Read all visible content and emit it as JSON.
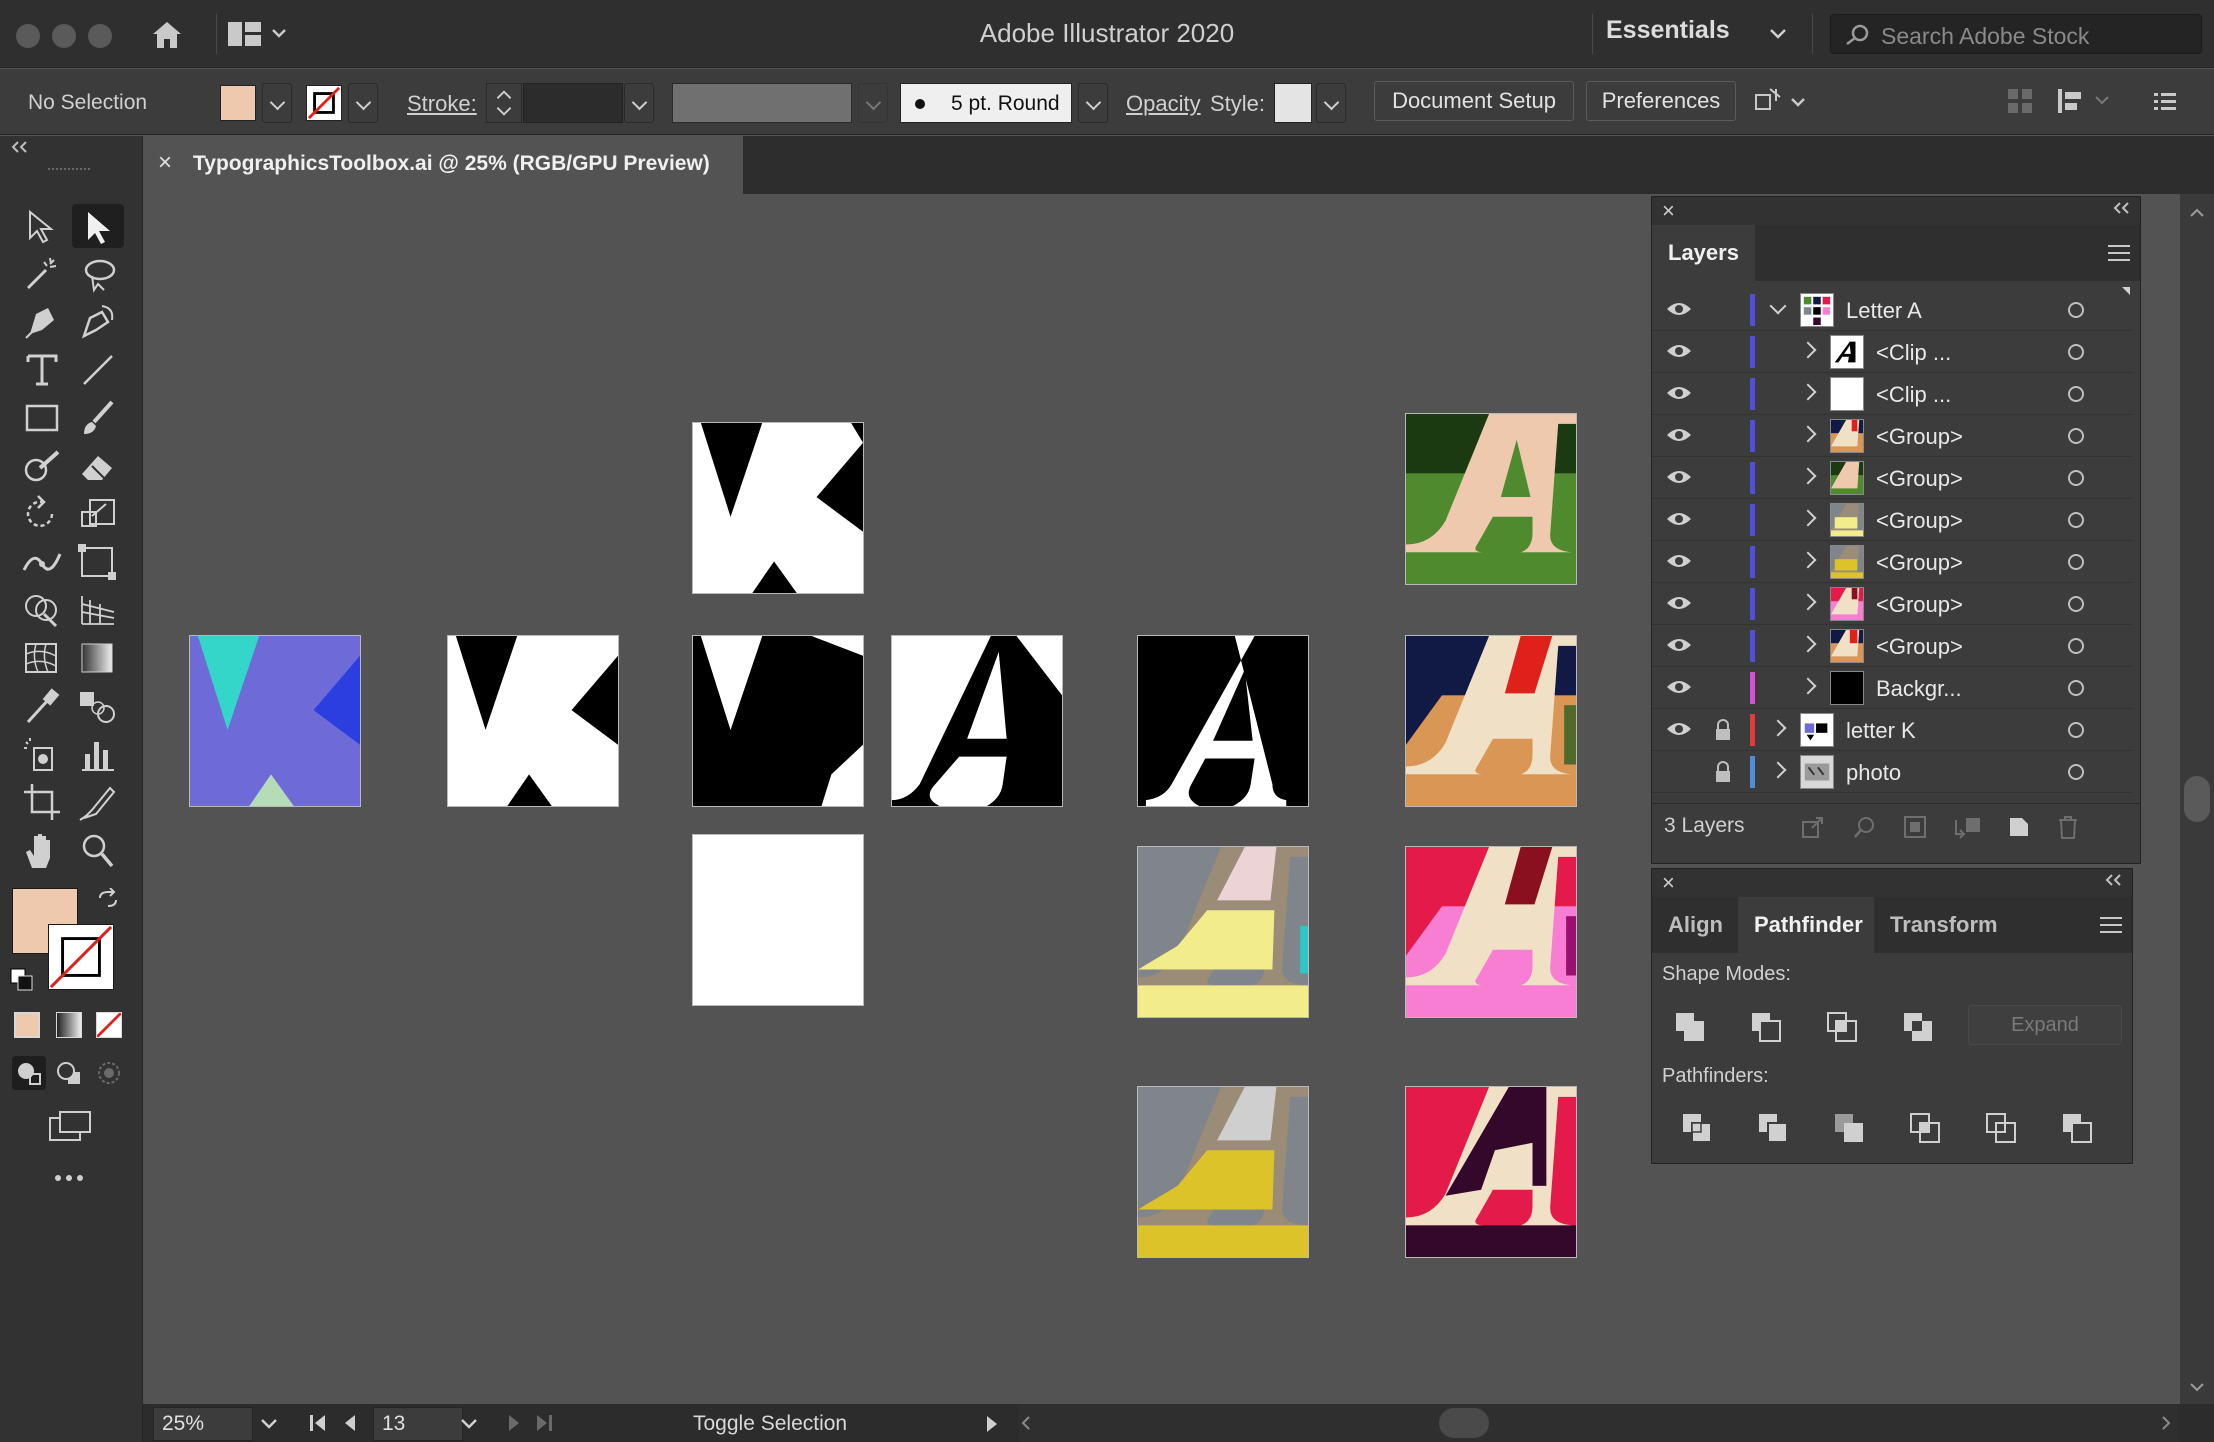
{
  "app": {
    "title": "Adobe Illustrator 2020",
    "workspace": "Essentials",
    "search_placeholder": "Search Adobe Stock"
  },
  "control_bar": {
    "selection_status": "No Selection",
    "fill_color": "#efc9ae",
    "stroke_label": "Stroke:",
    "brush": "5 pt. Round",
    "opacity_label": "Opacity",
    "style_label": "Style:",
    "document_setup": "Document Setup",
    "preferences": "Preferences"
  },
  "document_tab": {
    "title": "TypographicsToolbox.ai @ 25% (RGB/GPU Preview)"
  },
  "status_bar": {
    "zoom": "25%",
    "artboard": "13",
    "info": "Toggle Selection"
  },
  "layers_panel": {
    "tab": "Layers",
    "count_label": "3 Layers",
    "rows": [
      {
        "name": "Letter A",
        "color": "#4f4fd9",
        "level": 0,
        "expanded": true,
        "locked": false,
        "visible": true,
        "thumb": "letterA-multi"
      },
      {
        "name": "<Clip ...",
        "color": "#4f4fd9",
        "level": 1,
        "locked": false,
        "visible": true,
        "thumb": "a-white"
      },
      {
        "name": "<Clip ...",
        "color": "#4f4fd9",
        "level": 1,
        "locked": false,
        "visible": true,
        "thumb": "white"
      },
      {
        "name": "<Group>",
        "color": "#4f4fd9",
        "level": 1,
        "locked": false,
        "visible": true,
        "thumb": "navy-orange"
      },
      {
        "name": "<Group>",
        "color": "#4f4fd9",
        "level": 1,
        "locked": false,
        "visible": true,
        "thumb": "green"
      },
      {
        "name": "<Group>",
        "color": "#4f4fd9",
        "level": 1,
        "locked": false,
        "visible": true,
        "thumb": "gray-yellow"
      },
      {
        "name": "<Group>",
        "color": "#4f4fd9",
        "level": 1,
        "locked": false,
        "visible": true,
        "thumb": "gray-gold"
      },
      {
        "name": "<Group>",
        "color": "#4f4fd9",
        "level": 1,
        "locked": false,
        "visible": true,
        "thumb": "red-pink"
      },
      {
        "name": "<Group>",
        "color": "#4f4fd9",
        "level": 1,
        "locked": false,
        "visible": true,
        "thumb": "navy-red"
      },
      {
        "name": "Backgr...",
        "color": "#d94fd9",
        "level": 1,
        "locked": false,
        "visible": true,
        "thumb": "black"
      },
      {
        "name": "letter K",
        "color": "#e33a3a",
        "level": 0,
        "expanded": false,
        "locked": true,
        "visible": true,
        "thumb": "letterK"
      },
      {
        "name": "photo",
        "color": "#4f8fd9",
        "level": 0,
        "expanded": false,
        "locked": true,
        "visible": false,
        "thumb": "photo"
      }
    ]
  },
  "pathfinder_panel": {
    "tabs": [
      "Align",
      "Pathfinder",
      "Transform"
    ],
    "active_tab": "Pathfinder",
    "shape_modes_label": "Shape Modes:",
    "expand_label": "Expand",
    "pathfinders_label": "Pathfinders:"
  },
  "colors": {
    "fill": "#efc9ae",
    "k_purple": "#6e6bd9",
    "k_teal": "#33d6c8",
    "k_blue": "#2b3ee0",
    "k_mint": "#b5dbb7"
  }
}
